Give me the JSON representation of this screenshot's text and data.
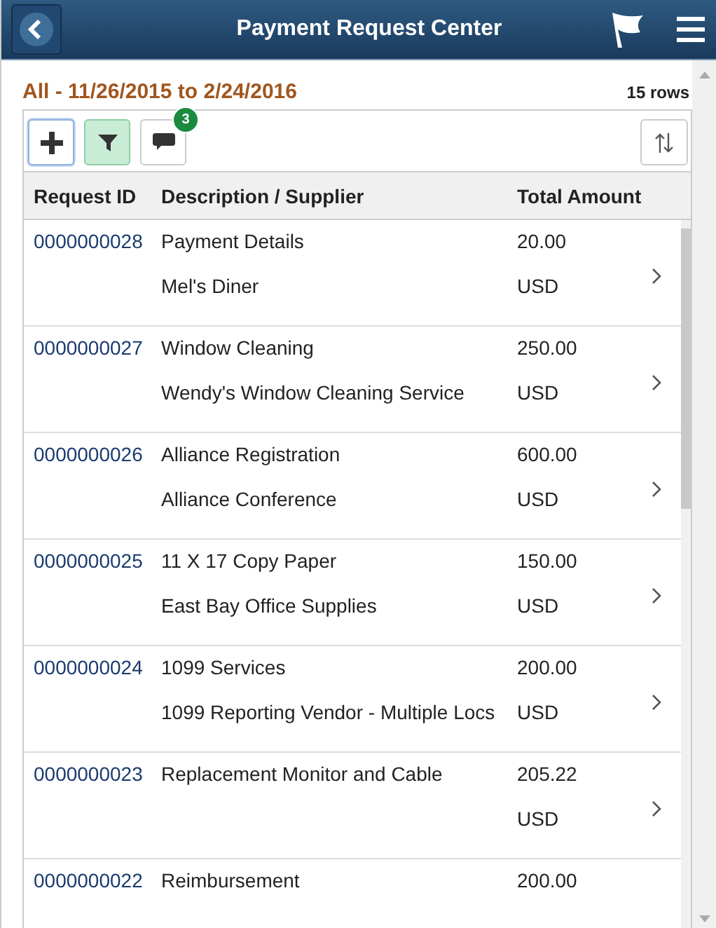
{
  "header": {
    "title": "Payment Request Center"
  },
  "list_title": "All - 11/26/2015 to 2/24/2016",
  "row_count": "15 rows",
  "toolbar": [
    {
      "kind": "add",
      "focused": true,
      "active": false
    },
    {
      "kind": "filter",
      "focused": false,
      "active": true
    },
    {
      "kind": "chat",
      "focused": false,
      "active": false,
      "badge": "3"
    }
  ],
  "table": {
    "columns": [
      "Request ID",
      "Description / Supplier",
      "Total Amount"
    ],
    "rows": [
      {
        "id": "0000000028",
        "description": "Payment Details",
        "supplier": "Mel's Diner",
        "amount": "20.00",
        "currency": "USD"
      },
      {
        "id": "0000000027",
        "description": "Window Cleaning",
        "supplier": "Wendy's Window Cleaning Service",
        "amount": "250.00",
        "currency": "USD"
      },
      {
        "id": "0000000026",
        "description": "Alliance Registration",
        "supplier": "Alliance Conference",
        "amount": "600.00",
        "currency": "USD"
      },
      {
        "id": "0000000025",
        "description": "11 X 17 Copy Paper",
        "supplier": "East Bay Office Supplies",
        "amount": "150.00",
        "currency": "USD"
      },
      {
        "id": "0000000024",
        "description": "1099 Services",
        "supplier": "1099 Reporting Vendor - Multiple Locs",
        "amount": "200.00",
        "currency": "USD"
      },
      {
        "id": "0000000023",
        "description": "Replacement Monitor and Cable",
        "amount": "205.22",
        "currency": "USD"
      },
      {
        "id": "0000000022",
        "description": "Reimbursement",
        "amount": "200.00"
      }
    ]
  }
}
